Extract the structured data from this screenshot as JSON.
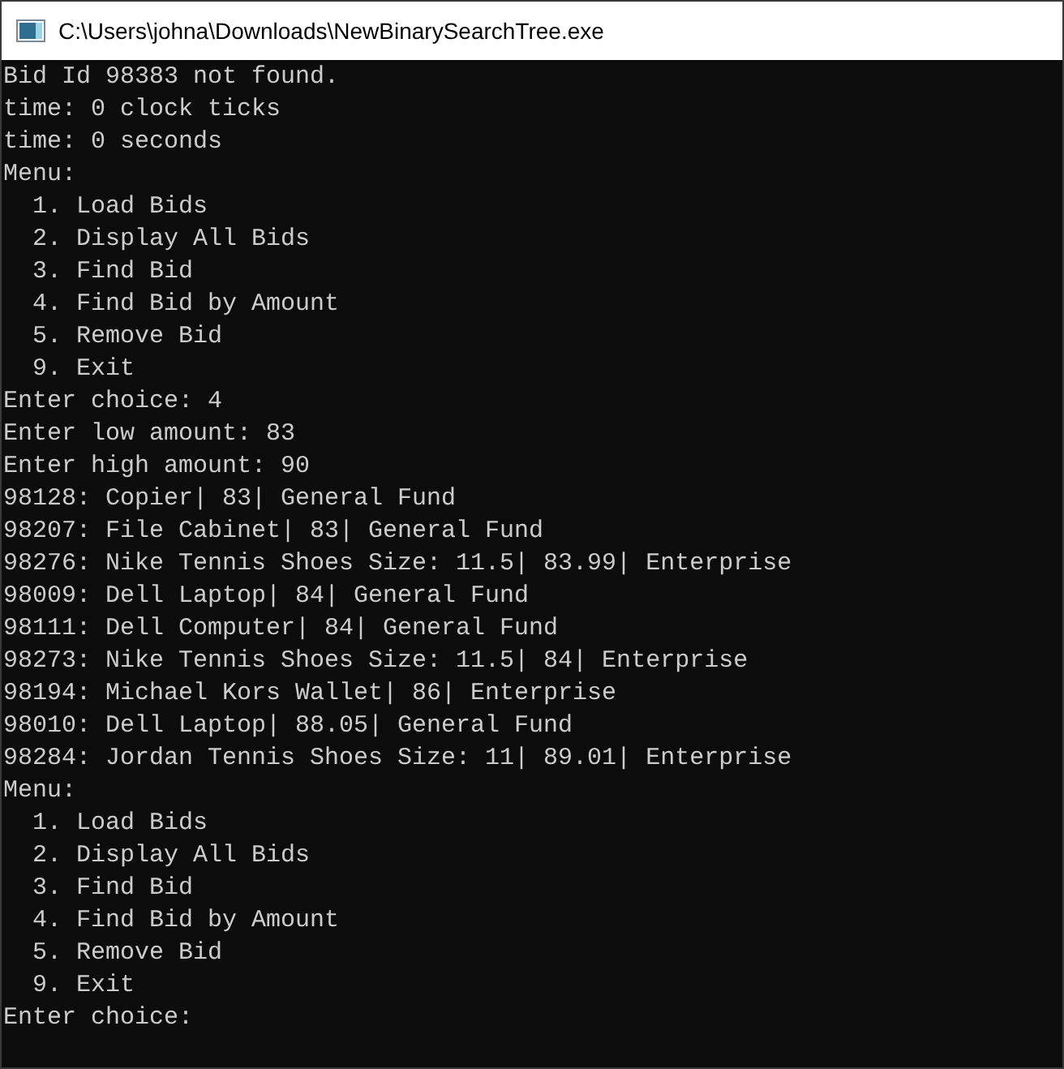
{
  "window": {
    "title": "C:\\Users\\johna\\Downloads\\NewBinarySearchTree.exe"
  },
  "console": {
    "lines": [
      "Bid Id 98383 not found.",
      "time: 0 clock ticks",
      "time: 0 seconds",
      "Menu:",
      "  1. Load Bids",
      "  2. Display All Bids",
      "  3. Find Bid",
      "  4. Find Bid by Amount",
      "  5. Remove Bid",
      "  9. Exit",
      "Enter choice: 4",
      "Enter low amount: 83",
      "Enter high amount: 90",
      "98128: Copier| 83| General Fund",
      "98207: File Cabinet| 83| General Fund",
      "98276: Nike Tennis Shoes Size: 11.5| 83.99| Enterprise",
      "98009: Dell Laptop| 84| General Fund",
      "98111: Dell Computer| 84| General Fund",
      "98273: Nike Tennis Shoes Size: 11.5| 84| Enterprise",
      "98194: Michael Kors Wallet| 86| Enterprise",
      "98010: Dell Laptop| 88.05| General Fund",
      "98284: Jordan Tennis Shoes Size: 11| 89.01| Enterprise",
      "Menu:",
      "  1. Load Bids",
      "  2. Display All Bids",
      "  3. Find Bid",
      "  4. Find Bid by Amount",
      "  5. Remove Bid",
      "  9. Exit",
      "Enter choice: "
    ]
  }
}
